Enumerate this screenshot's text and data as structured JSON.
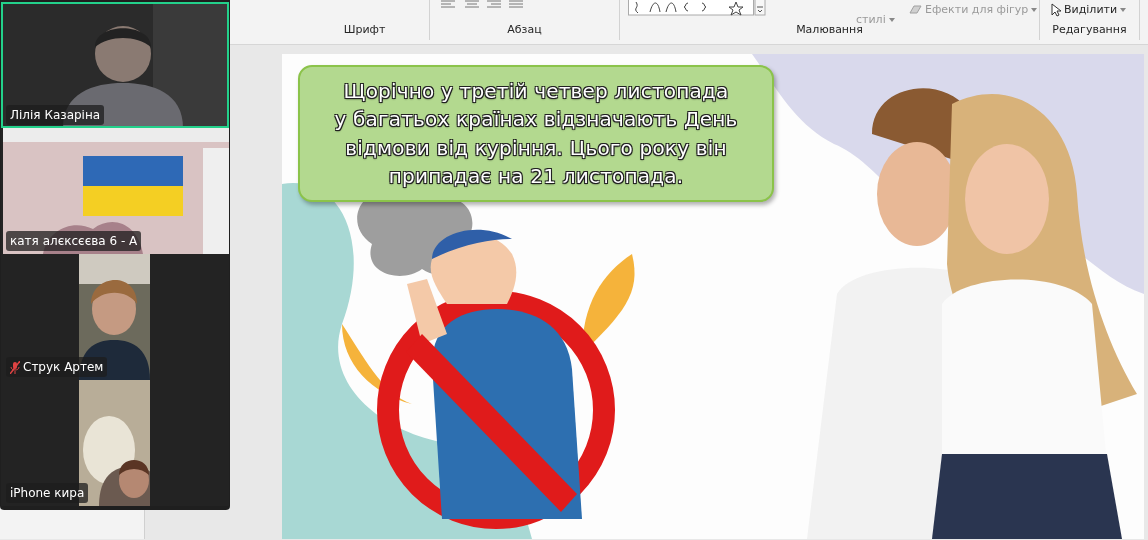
{
  "ribbon": {
    "groups": [
      {
        "label": "Шрифт"
      },
      {
        "label": "Абзац"
      },
      {
        "label": "Малювання"
      },
      {
        "label": "Редагування"
      }
    ],
    "commands": [
      {
        "kind": "styles",
        "label": "стилі"
      },
      {
        "kind": "effects",
        "label": "Ефекти для фігур"
      },
      {
        "kind": "select",
        "label": "Виділити"
      }
    ]
  },
  "slide": {
    "callout_lines": [
      "Щорічно у третій четвер листопада",
      "у багатьох країнах відзначають День",
      "відмови від куріння. Цього року він",
      "припадає на 21 листопада."
    ]
  },
  "participants": [
    {
      "name": "Лілія Казаріна",
      "active": true,
      "muted": false,
      "kind": "full"
    },
    {
      "name": "катя алєксєєва 6 - А",
      "active": false,
      "muted": false,
      "kind": "full"
    },
    {
      "name": "Струк Артем",
      "active": false,
      "muted": true,
      "kind": "narrow"
    },
    {
      "name": "iPhone кира",
      "active": false,
      "muted": false,
      "kind": "narrow"
    }
  ]
}
